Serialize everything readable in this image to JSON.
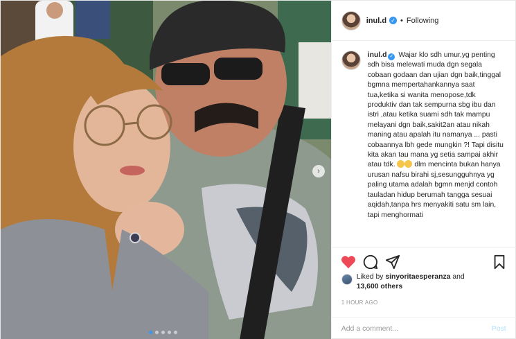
{
  "post": {
    "username": "inul.d",
    "follow_status": "Following",
    "separator": "•",
    "caption": {
      "username": "inul.d",
      "text_part1": "Wajar klo sdh umur,yg penting sdh bisa melewati muda dgn segala cobaan godaan dan ujian dgn baik,tinggal bgmna mempertahankannya saat tua,ketika si wanita menopose,tdk produktiv dan tak sempurna sbg ibu dan istri ,atau ketika suami sdh tak mampu melayani dgn baik,sakit2an atau nikah maning atau apalah itu namanya ... pasti cobaannya lbh gede mungkin ?! Tapi disitu kita akan tau mana yg setia sampai akhir atau tdk.",
      "text_part2": "dlm mencinta bukan hanya urusan nafsu birahi sj,sesungguhnya yg paling utama adalah bgmn menjd contoh tauladan hidup berumah tangga sesuai aqidah,tanpa hrs menyakiti satu sm lain, tapi menghormati"
    },
    "likes": {
      "prefix": "Liked by",
      "liker": "sinyoritaesperanza",
      "conjunction": "and",
      "others": "13,600 others"
    },
    "timestamp": "1 HOUR AGO",
    "comment": {
      "placeholder": "Add a comment...",
      "post_label": "Post"
    },
    "carousel": {
      "dot_count": 5,
      "active_index": 0,
      "next_glyph": "›"
    },
    "icons": {
      "like": "heart-icon",
      "comment": "comment-icon",
      "share": "share-icon",
      "save": "bookmark-icon"
    },
    "colors": {
      "like": "#ed4956",
      "verified": "#3897f0",
      "post_button_disabled": "#b2dffc"
    }
  }
}
